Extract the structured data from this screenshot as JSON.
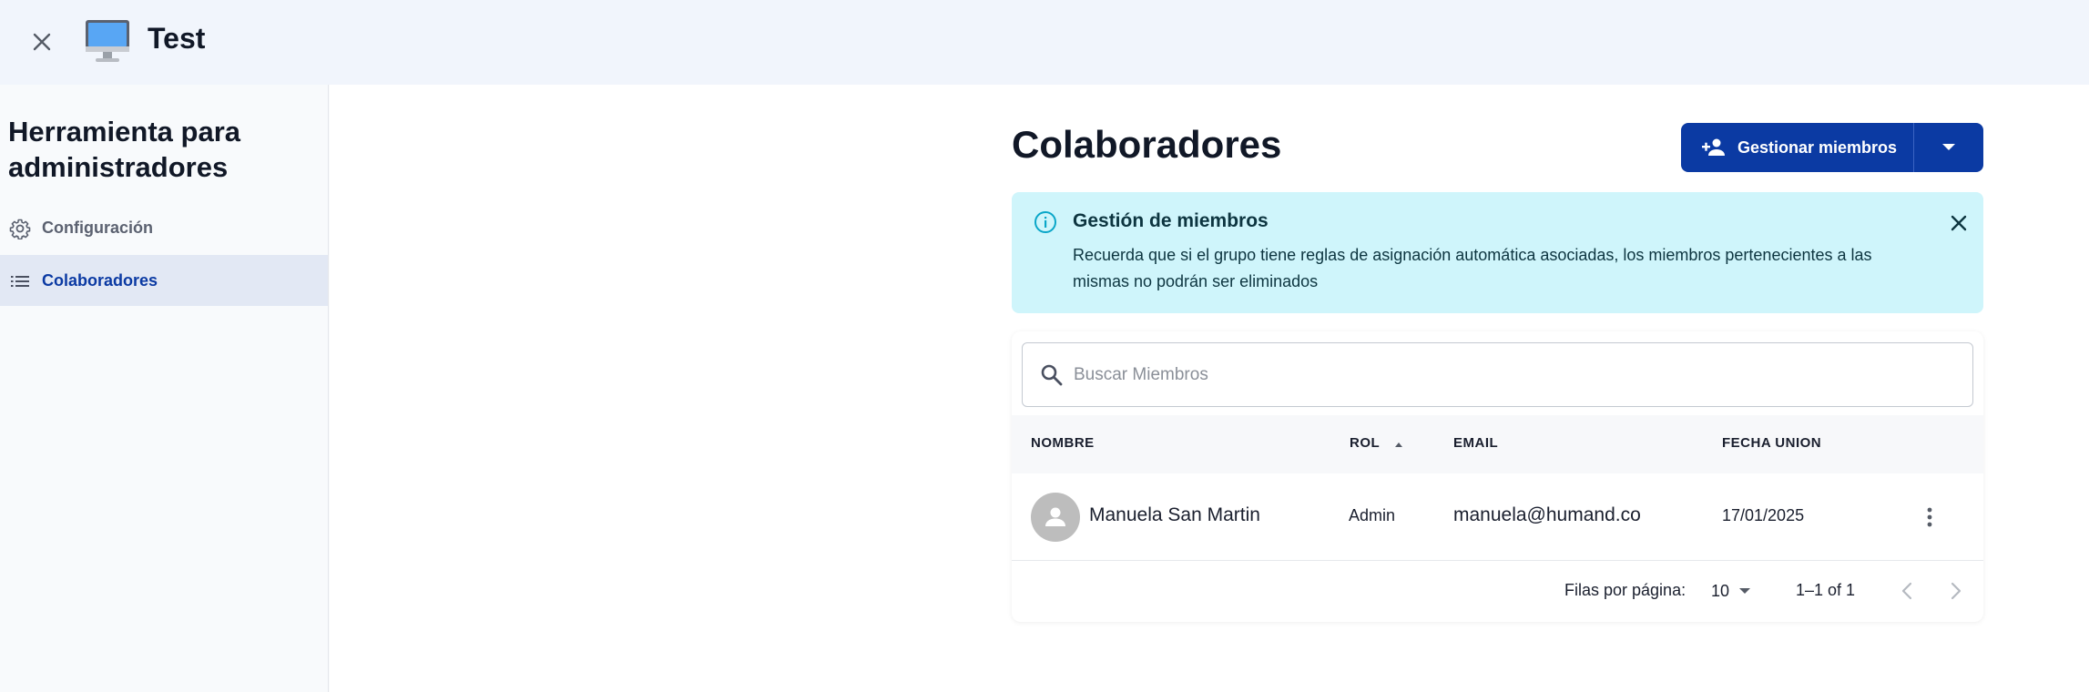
{
  "header": {
    "title": "Test",
    "app_icon": "desktop-computer-icon",
    "close_icon": "close-icon"
  },
  "sidebar": {
    "heading": "Herramienta para administradores",
    "items": [
      {
        "label": "Configuración",
        "icon": "gear-icon",
        "active": false
      },
      {
        "label": "Colaboradores",
        "icon": "list-icon",
        "active": true
      }
    ]
  },
  "main": {
    "title": "Colaboradores",
    "manage_button": {
      "label": "Gestionar miembros",
      "icon": "person-add-icon"
    },
    "alert": {
      "title": "Gestión de miembros",
      "body": "Recuerda que si el grupo tiene reglas de asignación automática asociadas, los miembros pertenecientes a las mismas no podrán ser eliminados"
    },
    "search": {
      "placeholder": "Buscar Miembros",
      "value": ""
    },
    "table": {
      "columns": [
        "NOMBRE",
        "ROL",
        "EMAIL",
        "FECHA UNION"
      ],
      "sort_column": "ROL",
      "sort_direction": "asc",
      "rows": [
        {
          "name": "Manuela San Martin",
          "role": "Admin",
          "email": "manuela@humand.co",
          "joined": "17/01/2025"
        }
      ]
    },
    "pagination": {
      "rows_label": "Filas por página:",
      "rows_per_page": "10",
      "range": "1–1 of 1"
    }
  },
  "colors": {
    "accent": "#0b3aa3",
    "alert_bg": "#cff5fb",
    "topbar_bg": "#f1f5fc",
    "active_nav_bg": "#e2e8f4"
  }
}
